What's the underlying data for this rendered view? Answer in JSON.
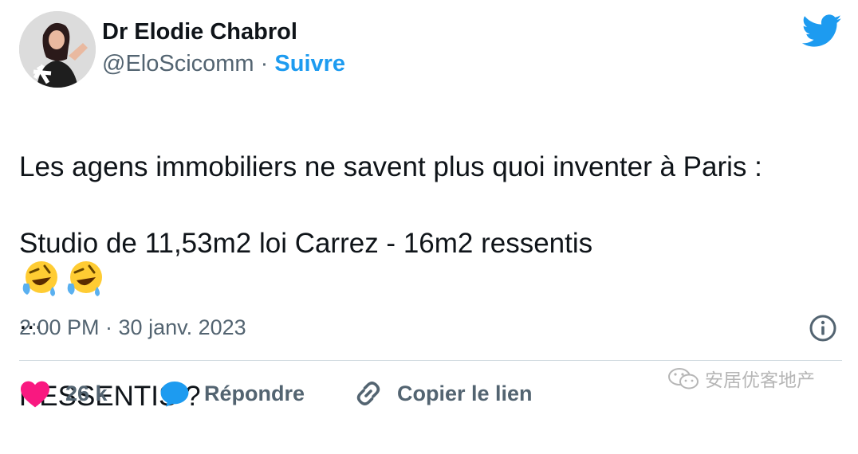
{
  "author": {
    "name": "Dr Elodie Chabrol",
    "handle": "@EloScicomm",
    "separator": "·",
    "follow_label": "Suivre",
    "avatar_icon": "profile-photo"
  },
  "brand_icon": "twitter-bird-icon",
  "tweet": {
    "lines": [
      "Les agens immobiliers ne savent plus quoi inventer à Paris :",
      "Studio de 11,53m2 loi Carrez - 16m2 ressentis",
      "...",
      "RESSENTIS ?"
    ],
    "emojis": [
      "rolling-on-floor-laughing",
      "rolling-on-floor-laughing"
    ],
    "timestamp": "2:00 PM · 30 janv. 2023"
  },
  "actions": {
    "like_count": "26 k",
    "reply_label": "Répondre",
    "copy_link_label": "Copier le lien"
  },
  "watermark": {
    "text": "安居优客地产",
    "icon": "wechat-icon"
  },
  "colors": {
    "accent": "#1d9bf0",
    "like": "#f91880",
    "muted": "#536471",
    "text": "#0f1419"
  }
}
